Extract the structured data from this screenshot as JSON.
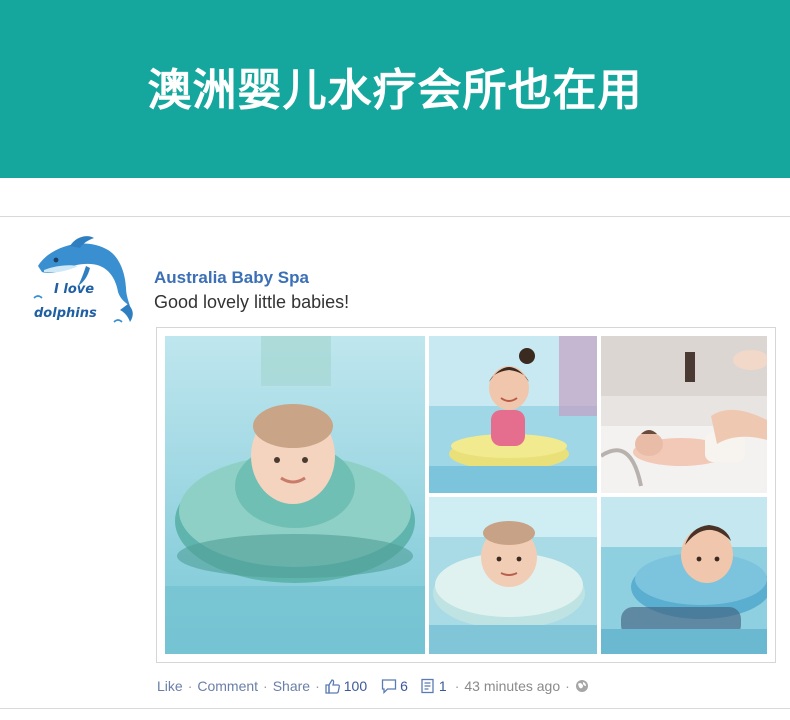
{
  "banner": {
    "title": "澳洲婴儿水疗会所也在用",
    "color": "#15a79d"
  },
  "profile": {
    "logo_text_line1": "I love",
    "logo_text_line2": "dolphins",
    "name": "Australia Baby Spa",
    "post_text": "Good lovely little babies!"
  },
  "photos": [
    {
      "description": "baby-in-neck-float-1"
    },
    {
      "description": "toddler-in-yellow-ring"
    },
    {
      "description": "newborn-massage"
    },
    {
      "description": "baby-in-neck-float-2"
    },
    {
      "description": "baby-in-blue-neck-float"
    }
  ],
  "actions": {
    "like": "Like",
    "comment": "Comment",
    "share": "Share",
    "like_count": "100",
    "comment_count": "6",
    "share_count": "1",
    "timestamp": "43 minutes ago",
    "separator": "·"
  }
}
